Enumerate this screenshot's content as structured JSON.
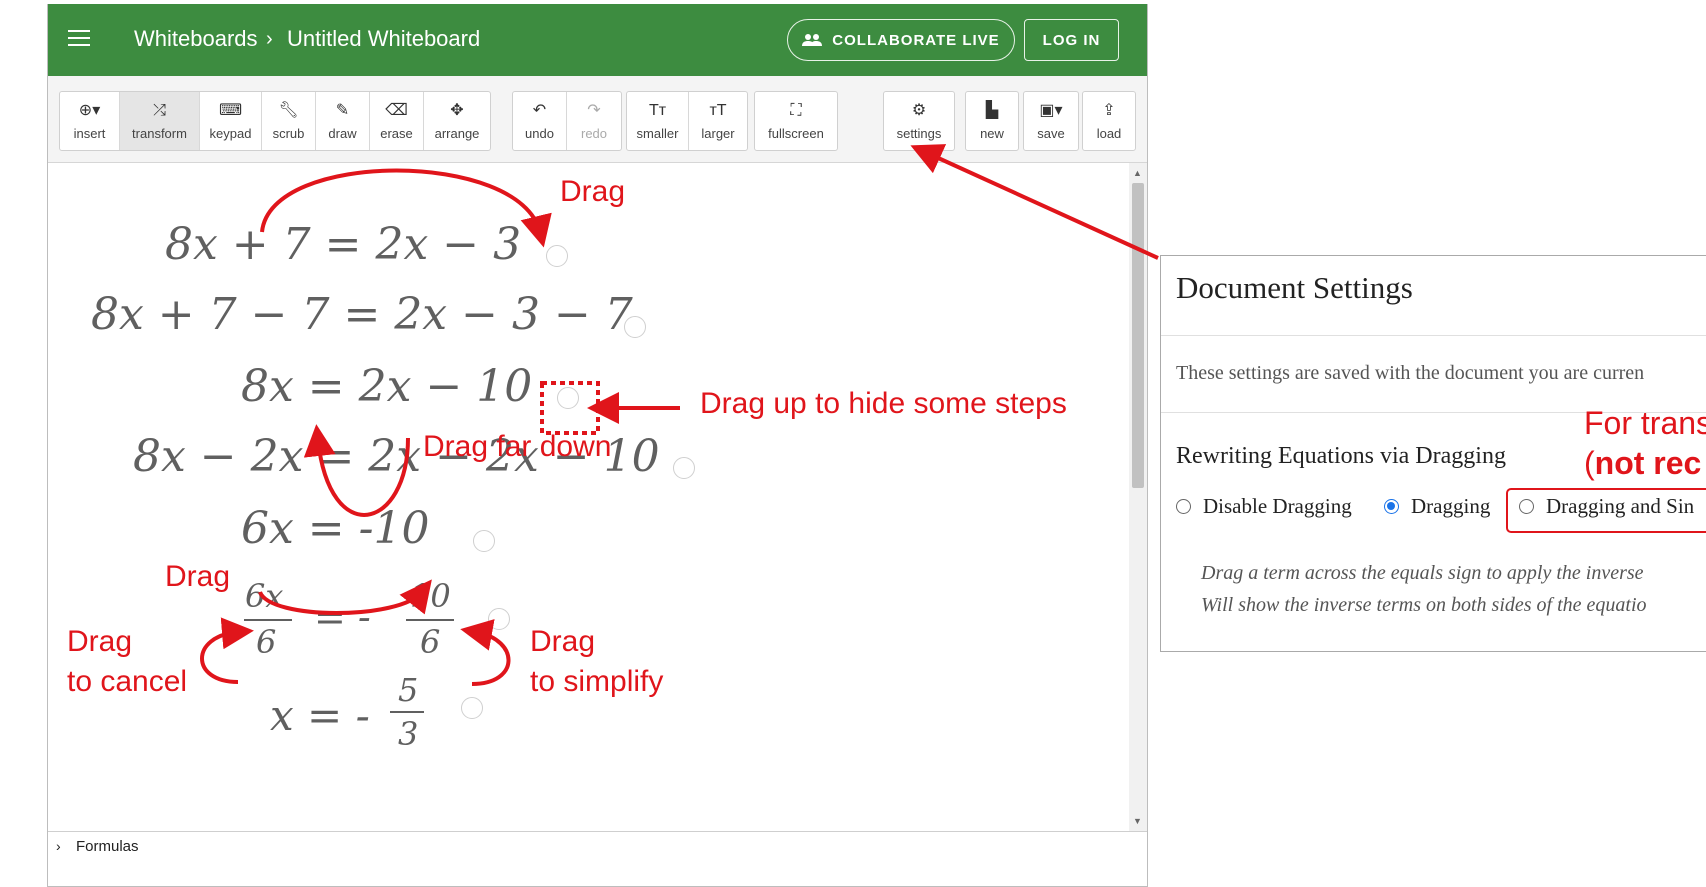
{
  "header": {
    "breadcrumb_root": "Whiteboards",
    "breadcrumb_sep": "›",
    "breadcrumb_current": "Untitled Whiteboard",
    "collaborate_label": "COLLABORATE LIVE",
    "login_label": "LOG IN"
  },
  "toolbar": {
    "insert": "insert",
    "transform": "transform",
    "keypad": "keypad",
    "scrub": "scrub",
    "draw": "draw",
    "erase": "erase",
    "arrange": "arrange",
    "undo": "undo",
    "redo": "redo",
    "smaller": "smaller",
    "larger": "larger",
    "fullscreen": "fullscreen",
    "settings": "settings",
    "new": "new",
    "save": "save",
    "load": "load"
  },
  "equations": {
    "eq1": "8x + 7 = 2x − 3",
    "eq2": "8x + 7 − 7 = 2x − 3 − 7",
    "eq3": "8x = 2x − 10",
    "eq4": "8x − 2x = 2x − 2x − 10",
    "eq5": "6x = -10",
    "eq6_num_left": "6x",
    "eq6_den_left": "6",
    "eq6_mid": "= -",
    "eq6_num_right": "10",
    "eq6_den_right": "6",
    "eq7_left": "x = -",
    "eq7_num": "5",
    "eq7_den": "3"
  },
  "annotations": {
    "drag_top": "Drag",
    "drag_up": "Drag up to hide some steps",
    "drag_far_down": "Drag far down",
    "drag_left": "Drag",
    "drag_cancel_1": "Drag",
    "drag_cancel_2": "to cancel",
    "drag_simplify_1": "Drag",
    "drag_simplify_2": "to simplify",
    "for_trans": "For trans",
    "not_rec_prefix": "(",
    "not_rec": "not rec"
  },
  "formulas_label": "Formulas",
  "settings": {
    "title": "Document Settings",
    "description": "These settings are saved with the document you are curren",
    "subtitle": "Rewriting Equations via Dragging",
    "options": [
      "Disable Dragging",
      "Dragging",
      "Dragging and Sin"
    ],
    "selected": "Dragging",
    "note_1": "Drag a term across the equals sign to apply the inverse",
    "note_2": "Will show the inverse terms on both sides of the equatio"
  },
  "colors": {
    "header_green": "#3d8c40",
    "annotation_red": "#e0151b",
    "radio_blue": "#1a73e8"
  }
}
